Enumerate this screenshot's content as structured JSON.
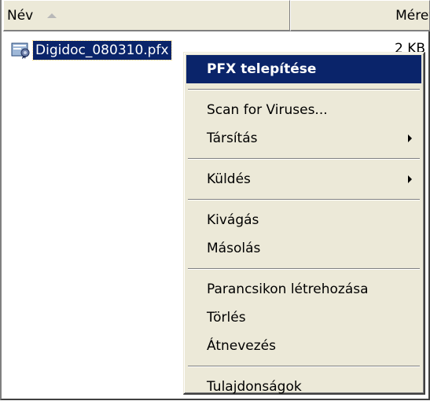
{
  "columns": {
    "name": "Név",
    "size": "Méret"
  },
  "file": {
    "name": "Digidoc_080310.pfx",
    "size": "2 KB",
    "icon": "certificate-file-icon"
  },
  "context_menu": {
    "items": {
      "install_pfx": "PFX telepítése",
      "scan": "Scan for Viruses...",
      "associate": "Társítás",
      "send": "Küldés",
      "cut": "Kivágás",
      "copy": "Másolás",
      "create_shortcut": "Parancsikon létrehozása",
      "delete": "Törlés",
      "rename": "Átnevezés",
      "properties": "Tulajdonságok"
    }
  },
  "colors": {
    "selection": "#0a246a",
    "menu_bg": "#ece9d8"
  }
}
